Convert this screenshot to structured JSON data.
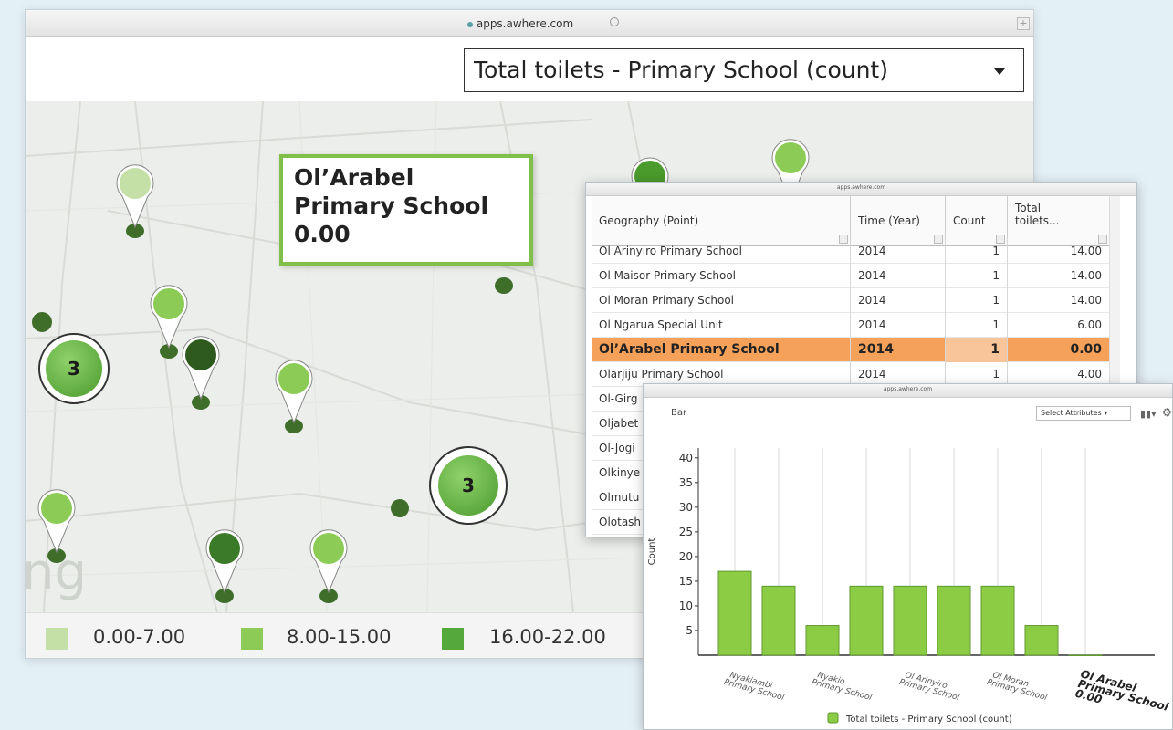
{
  "browser": {
    "url": "apps.awhere.com"
  },
  "attribute_select": {
    "value": "Total toilets - Primary School (count)"
  },
  "callout": {
    "line1": "Ol’Arabel",
    "line2": "Primary School",
    "line3": "0.00"
  },
  "clusters": [
    {
      "count": "3"
    },
    {
      "count": "3"
    }
  ],
  "map_watermark": "ng",
  "legend": [
    {
      "label": "0.00-7.00",
      "color": "#c5e0a6"
    },
    {
      "label": "8.00-15.00",
      "color": "#8ccc56"
    },
    {
      "label": "16.00-22.00",
      "color": "#55a83a"
    }
  ],
  "table_window": {
    "url": "apps.awhere.com",
    "columns": [
      "Geography (Point)",
      "Time (Year)",
      "Count",
      "Total toilets..."
    ],
    "rows": [
      {
        "geo": "Ol Arinyiro Primary School",
        "year": "2014",
        "count": "1",
        "total": "14.00"
      },
      {
        "geo": "Ol Maisor Primary School",
        "year": "2014",
        "count": "1",
        "total": "14.00"
      },
      {
        "geo": "Ol Moran Primary School",
        "year": "2014",
        "count": "1",
        "total": "14.00"
      },
      {
        "geo": "Ol Ngarua Special Unit",
        "year": "2014",
        "count": "1",
        "total": "6.00"
      },
      {
        "geo": "Ol’Arabel Primary School",
        "year": "2014",
        "count": "1",
        "total": "0.00"
      },
      {
        "geo": "Olarjiju Primary School",
        "year": "2014",
        "count": "1",
        "total": "4.00"
      },
      {
        "geo": "Ol-Girg",
        "year": "",
        "count": "",
        "total": ""
      },
      {
        "geo": "Oljabet",
        "year": "",
        "count": "",
        "total": ""
      },
      {
        "geo": "Ol-Jogi",
        "year": "",
        "count": "",
        "total": ""
      },
      {
        "geo": "Olkinye",
        "year": "",
        "count": "",
        "total": ""
      },
      {
        "geo": "Olmutu",
        "year": "",
        "count": "",
        "total": ""
      },
      {
        "geo": "Olotash",
        "year": "",
        "count": "",
        "total": ""
      }
    ],
    "selected_row": 4
  },
  "chart_window": {
    "url": "apps.awhere.com",
    "title": "Bar",
    "select_label": "Select Attributes",
    "bar_color": "#8ccc45"
  },
  "chart_data": {
    "type": "bar",
    "title": "Bar",
    "ylabel": "Count",
    "xlabel": "",
    "ylim": [
      0,
      42
    ],
    "yticks": [
      5,
      10,
      15,
      20,
      25,
      30,
      35,
      40
    ],
    "values": [
      17,
      14,
      6,
      14,
      14,
      14,
      14,
      6,
      0
    ],
    "category_labels": [
      {
        "index": 0,
        "text": "Nyakiambi Primary School"
      },
      {
        "index": 2,
        "text": "Nyakio Primary School"
      },
      {
        "index": 4,
        "text": "Ol Arinyiro Primary School"
      },
      {
        "index": 6,
        "text": "Ol Moran Primary School"
      },
      {
        "index": 8,
        "text": "Ol Arabel Primary School 0.00"
      }
    ],
    "legend": [
      "Total toilets - Primary School (count)"
    ],
    "grid": true
  }
}
